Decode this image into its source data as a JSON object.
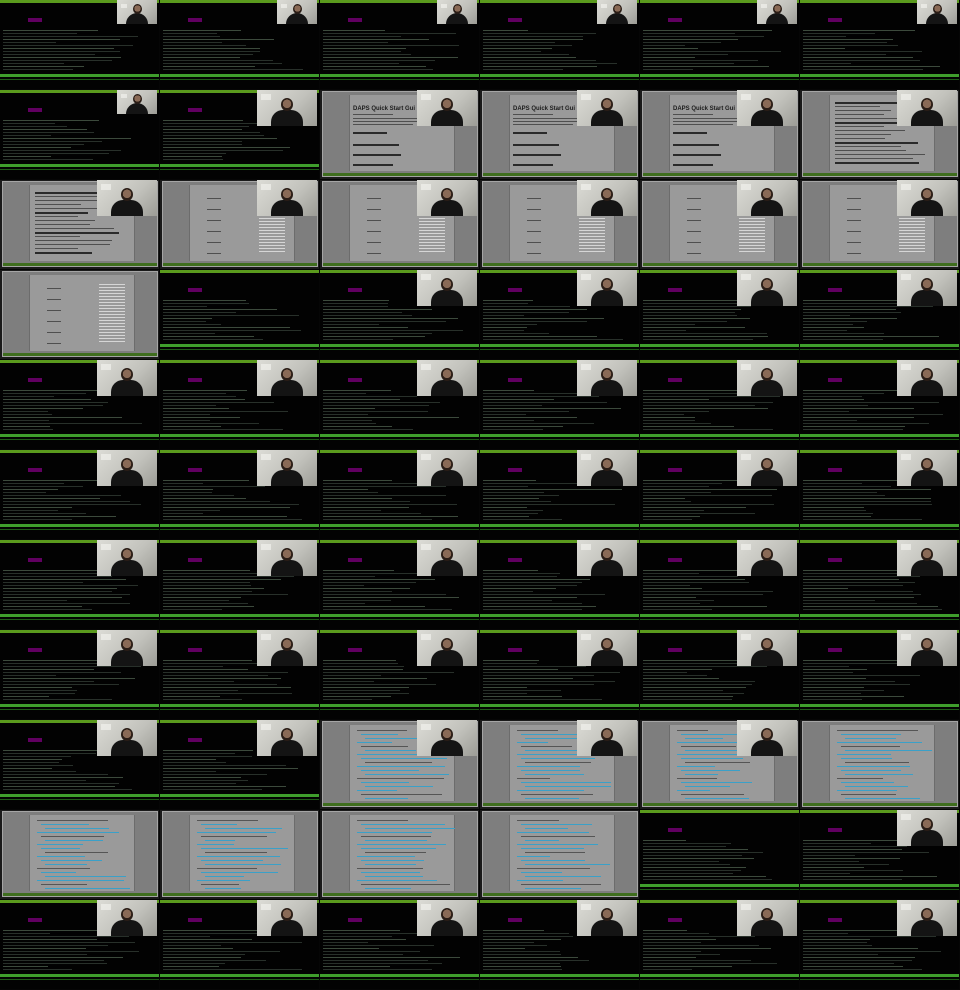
{
  "sheet": {
    "columns": 6,
    "rows": 11
  },
  "colors": {
    "terminal_bg": "#020202",
    "accent_green": "#5a9a1d",
    "status_green": "#3f9e2c",
    "prompt_magenta": "#b000b0",
    "document_gray": "#9a9a9a",
    "webcam_wall": "#dcdcd6"
  },
  "doc_titles": {
    "quick_start": "DAPS Quick Start Gui"
  },
  "frames": [
    {
      "kind": "terminal",
      "cam": "small"
    },
    {
      "kind": "terminal",
      "cam": "small"
    },
    {
      "kind": "terminal",
      "cam": "small"
    },
    {
      "kind": "terminal",
      "cam": "small"
    },
    {
      "kind": "terminal",
      "cam": "small"
    },
    {
      "kind": "terminal",
      "cam": "small"
    },
    {
      "kind": "terminal",
      "cam": "small"
    },
    {
      "kind": "terminal",
      "cam": "large"
    },
    {
      "kind": "document",
      "variant": "title",
      "cam": "large",
      "title": "doc_titles.quick_start"
    },
    {
      "kind": "document",
      "variant": "title",
      "cam": "large",
      "title": "doc_titles.quick_start"
    },
    {
      "kind": "document",
      "variant": "title",
      "cam": "large",
      "title": "doc_titles.quick_start"
    },
    {
      "kind": "document",
      "variant": "text",
      "cam": "large"
    },
    {
      "kind": "document",
      "variant": "text",
      "cam": "large"
    },
    {
      "kind": "document",
      "variant": "table",
      "cam": "large"
    },
    {
      "kind": "document",
      "variant": "table",
      "cam": "large"
    },
    {
      "kind": "document",
      "variant": "table",
      "cam": "large"
    },
    {
      "kind": "document",
      "variant": "table",
      "cam": "large"
    },
    {
      "kind": "document",
      "variant": "table",
      "cam": "large"
    },
    {
      "kind": "document",
      "variant": "table",
      "cam": "none"
    },
    {
      "kind": "terminal",
      "cam": "none"
    },
    {
      "kind": "terminal",
      "cam": "large"
    },
    {
      "kind": "terminal",
      "cam": "large"
    },
    {
      "kind": "terminal",
      "cam": "large"
    },
    {
      "kind": "terminal",
      "cam": "large"
    },
    {
      "kind": "terminal",
      "cam": "large"
    },
    {
      "kind": "terminal",
      "cam": "large"
    },
    {
      "kind": "terminal",
      "cam": "large"
    },
    {
      "kind": "terminal",
      "cam": "large"
    },
    {
      "kind": "terminal",
      "cam": "large"
    },
    {
      "kind": "terminal",
      "cam": "large"
    },
    {
      "kind": "terminal",
      "cam": "large"
    },
    {
      "kind": "terminal",
      "cam": "large"
    },
    {
      "kind": "terminal",
      "cam": "large"
    },
    {
      "kind": "terminal",
      "cam": "large"
    },
    {
      "kind": "terminal",
      "cam": "large"
    },
    {
      "kind": "terminal",
      "cam": "large"
    },
    {
      "kind": "terminal",
      "cam": "large"
    },
    {
      "kind": "terminal",
      "cam": "large"
    },
    {
      "kind": "terminal",
      "cam": "large"
    },
    {
      "kind": "terminal",
      "cam": "large"
    },
    {
      "kind": "terminal",
      "cam": "large"
    },
    {
      "kind": "terminal",
      "cam": "large"
    },
    {
      "kind": "terminal",
      "cam": "large"
    },
    {
      "kind": "terminal",
      "cam": "large"
    },
    {
      "kind": "terminal",
      "cam": "large"
    },
    {
      "kind": "terminal",
      "cam": "large"
    },
    {
      "kind": "terminal",
      "cam": "large"
    },
    {
      "kind": "terminal",
      "cam": "large"
    },
    {
      "kind": "terminal",
      "cam": "large"
    },
    {
      "kind": "terminal",
      "cam": "large"
    },
    {
      "kind": "document",
      "variant": "code",
      "cam": "large"
    },
    {
      "kind": "document",
      "variant": "code",
      "cam": "large"
    },
    {
      "kind": "document",
      "variant": "code",
      "cam": "large"
    },
    {
      "kind": "document",
      "variant": "code",
      "cam": "none"
    },
    {
      "kind": "document",
      "variant": "code",
      "cam": "none"
    },
    {
      "kind": "document",
      "variant": "code",
      "cam": "none"
    },
    {
      "kind": "document",
      "variant": "code",
      "cam": "none"
    },
    {
      "kind": "document",
      "variant": "code",
      "cam": "none"
    },
    {
      "kind": "terminal",
      "cam": "none"
    },
    {
      "kind": "terminal",
      "cam": "large"
    },
    {
      "kind": "terminal",
      "cam": "large"
    },
    {
      "kind": "terminal",
      "cam": "large"
    },
    {
      "kind": "terminal",
      "cam": "large"
    },
    {
      "kind": "terminal",
      "cam": "large"
    },
    {
      "kind": "terminal",
      "cam": "large"
    },
    {
      "kind": "terminal",
      "cam": "large"
    }
  ]
}
